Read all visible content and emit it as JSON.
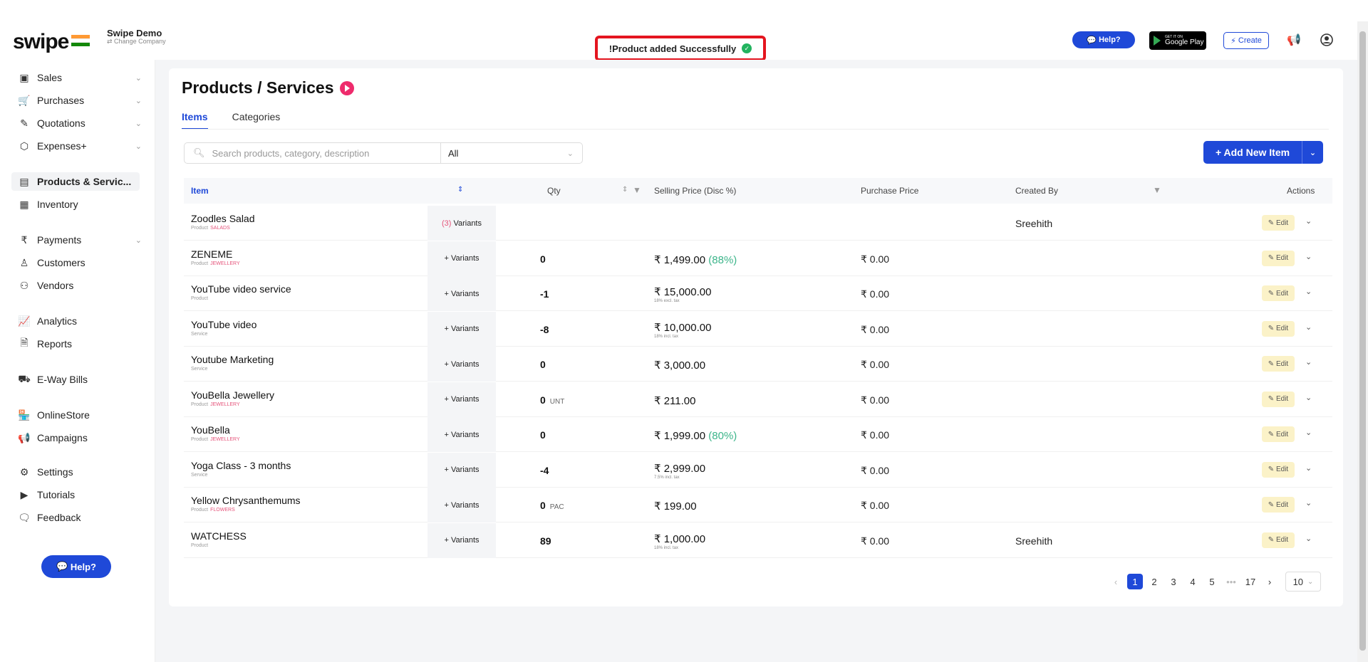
{
  "brand": {
    "logo": "swipe",
    "company_name": "Swipe Demo",
    "change_company": "Change Company"
  },
  "toast": {
    "message": "!Product added Successfully"
  },
  "header": {
    "help": "Help?",
    "google_play_small": "GET IT ON",
    "google_play": "Google Play",
    "create": "Create"
  },
  "sidebar": {
    "items": [
      {
        "label": "Sales",
        "icon": "sales-icon",
        "chev": "⌄"
      },
      {
        "label": "Purchases",
        "icon": "cart-icon",
        "chev": "⌄"
      },
      {
        "label": "Quotations",
        "icon": "pen-icon",
        "chev": "⌄"
      },
      {
        "label": "Expenses+",
        "icon": "tag-icon",
        "chev": "⌄"
      },
      {
        "label": "Products & Servic...",
        "icon": "box-icon",
        "active": true
      },
      {
        "label": "Inventory",
        "icon": "inventory-icon"
      },
      {
        "label": "Payments",
        "icon": "rupee-icon",
        "chev": "⌄"
      },
      {
        "label": "Customers",
        "icon": "user-icon"
      },
      {
        "label": "Vendors",
        "icon": "users-icon"
      },
      {
        "label": "Analytics",
        "icon": "chart-icon"
      },
      {
        "label": "Reports",
        "icon": "report-icon"
      },
      {
        "label": "E-Way Bills",
        "icon": "truck-icon"
      },
      {
        "label": "OnlineStore",
        "icon": "store-icon"
      },
      {
        "label": "Campaigns",
        "icon": "megaphone-icon"
      },
      {
        "label": "Settings",
        "icon": "gear-icon"
      },
      {
        "label": "Tutorials",
        "icon": "youtube-icon"
      },
      {
        "label": "Feedback",
        "icon": "chat-icon"
      }
    ],
    "help": "Help?"
  },
  "page": {
    "title": "Products / Services",
    "tabs": [
      "Items",
      "Categories"
    ],
    "search_placeholder": "Search products, category, description",
    "filter_value": "All",
    "add_button": "+ Add New Item"
  },
  "table": {
    "headers": {
      "item": "Item",
      "qty": "Qty",
      "selling_price": "Selling Price (Disc %)",
      "purchase_price": "Purchase Price",
      "created_by": "Created By",
      "actions": "Actions"
    },
    "rows": [
      {
        "name": "Zoodles Salad",
        "type": "Product",
        "category": "SALADS",
        "variants": "Variants",
        "variant_count": "(3)",
        "qty": "",
        "unit": "",
        "price": "",
        "disc": "",
        "note": "",
        "purchase": "",
        "created_by": "Sreehith",
        "thumb": "#8a9a78"
      },
      {
        "name": "ZENEME",
        "type": "Product",
        "category": "JEWELLERY",
        "variants": "+ Variants",
        "variant_count": "",
        "qty": "0",
        "unit": "",
        "price": "₹ 1,499.00",
        "disc": "(88%)",
        "note": "",
        "purchase": "₹ 0.00",
        "created_by": "",
        "thumb": "#c9a04a"
      },
      {
        "name": "YouTube video service",
        "type": "Product",
        "category": "",
        "variants": "+ Variants",
        "variant_count": "",
        "qty": "-1",
        "unit": "",
        "price": "₹ 15,000.00",
        "disc": "",
        "note": "18% excl. tax",
        "purchase": "₹ 0.00",
        "created_by": "",
        "thumb": ""
      },
      {
        "name": "YouTube video",
        "type": "Service",
        "category": "",
        "variants": "+ Variants",
        "variant_count": "",
        "qty": "-8",
        "unit": "",
        "price": "₹ 10,000.00",
        "disc": "",
        "note": "18% incl. tax",
        "purchase": "₹ 0.00",
        "created_by": "",
        "thumb": ""
      },
      {
        "name": "Youtube Marketing",
        "type": "Service",
        "category": "",
        "variants": "+ Variants",
        "variant_count": "",
        "qty": "0",
        "unit": "",
        "price": "₹ 3,000.00",
        "disc": "",
        "note": "",
        "purchase": "₹ 0.00",
        "created_by": "",
        "thumb": ""
      },
      {
        "name": "YouBella Jewellery",
        "type": "Product",
        "category": "JEWELLERY",
        "variants": "+ Variants",
        "variant_count": "",
        "qty": "0",
        "unit": "UNT",
        "price": "₹ 211.00",
        "disc": "",
        "note": "",
        "purchase": "₹ 0.00",
        "created_by": "",
        "thumb": "#b8874a"
      },
      {
        "name": "YouBella",
        "type": "Product",
        "category": "JEWELLERY",
        "variants": "+ Variants",
        "variant_count": "",
        "qty": "0",
        "unit": "",
        "price": "₹ 1,999.00",
        "disc": "(80%)",
        "note": "",
        "purchase": "₹ 0.00",
        "created_by": "",
        "thumb": "#d6c3a0"
      },
      {
        "name": "Yoga Class - 3 months",
        "type": "Service",
        "category": "",
        "variants": "+ Variants",
        "variant_count": "",
        "qty": "-4",
        "unit": "",
        "price": "₹ 2,999.00",
        "disc": "",
        "note": "7.5% incl. tax",
        "purchase": "₹ 0.00",
        "created_by": "",
        "thumb": ""
      },
      {
        "name": "Yellow Chrysanthemums",
        "type": "Product",
        "category": "FLOWERS",
        "variants": "+ Variants",
        "variant_count": "",
        "qty": "0",
        "unit": "PAC",
        "price": "₹ 199.00",
        "disc": "",
        "note": "",
        "purchase": "₹ 0.00",
        "created_by": "",
        "thumb": "#9a8a3a"
      },
      {
        "name": "WATCHESS",
        "type": "Product",
        "category": "",
        "variants": "+ Variants",
        "variant_count": "",
        "qty": "89",
        "unit": "",
        "price": "₹ 1,000.00",
        "disc": "",
        "note": "18% incl. tax",
        "purchase": "₹ 0.00",
        "created_by": "Sreehith",
        "thumb": ""
      }
    ],
    "edit_label": "Edit"
  },
  "pagination": {
    "pages": [
      "1",
      "2",
      "3",
      "4",
      "5"
    ],
    "ellipsis": "•••",
    "last": "17",
    "current": "1",
    "page_size": "10"
  }
}
